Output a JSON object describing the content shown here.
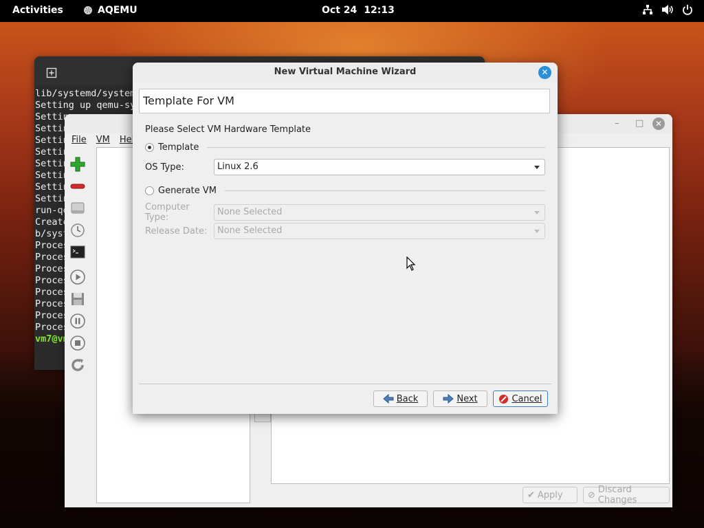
{
  "topbar": {
    "activities": "Activities",
    "app_name": "AQEMU",
    "date": "Oct 24",
    "time": "12:13"
  },
  "terminal": {
    "lines": [
      "lib/systemd/system",
      "Setting up qemu-sy",
      "Settin",
      "Settin",
      "Settin",
      "Settin",
      "Settin",
      "Settin",
      "Settin",
      "Settin",
      "run-qe",
      "Create",
      "b/syst",
      "Proces",
      "Proces",
      "Proces",
      "Proces",
      "Proces",
      "Proces",
      "Proces",
      "Proces"
    ],
    "prompt": "vm7@vm"
  },
  "main_window": {
    "menu": [
      "File",
      "VM",
      "Hel"
    ],
    "toolbar_icons": [
      "add-vm-icon",
      "remove-vm-icon",
      "disk-icon",
      "clock-icon",
      "terminal-icon",
      "play-icon",
      "save-icon",
      "pause-icon",
      "stop-icon",
      "reset-icon"
    ],
    "apply_label": "Apply",
    "discard_label": "Discard Changes"
  },
  "dialog": {
    "title": "New Virtual Machine Wizard",
    "header": "Template For VM",
    "prompt": "Please Select VM Hardware Template",
    "template_radio": "Template",
    "os_type_label": "OS Type:",
    "os_type_value": "Linux 2.6",
    "generate_radio": "Generate VM",
    "computer_type_label": "Computer Type:",
    "computer_type_value": "None Selected",
    "release_date_label": "Release Date:",
    "release_date_value": "None Selected",
    "back_label": "Back",
    "next_label": "Next",
    "cancel_label": "Cancel",
    "selected_option": "Template"
  }
}
